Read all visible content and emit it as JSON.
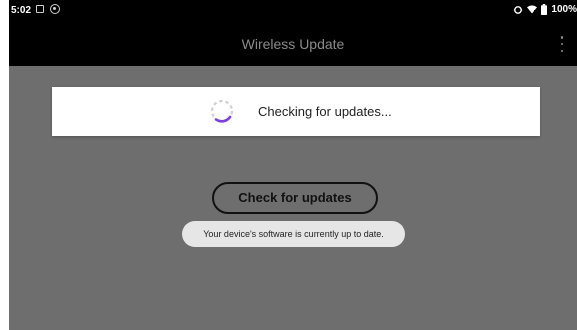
{
  "status_bar": {
    "time": "5:02",
    "battery": "100%"
  },
  "app_bar": {
    "title": "Wireless Update"
  },
  "main": {
    "check_button_label": "Check for updates"
  },
  "progress_dialog": {
    "message": "Checking for updates..."
  },
  "toast": {
    "message": "Your device's software is currently up to date."
  },
  "icons": {
    "status_left": [
      "notification-square-icon",
      "notification-circle-icon"
    ],
    "status_right": [
      "sync-icon",
      "wifi-icon",
      "battery-icon"
    ],
    "app_bar": "more-vert-icon",
    "dialog": "spinner-icon"
  },
  "colors": {
    "status_bar": "#000000",
    "app_bar": "#000000",
    "background": "#6e6e6e",
    "dialog": "#ffffff",
    "spinner_accent": "#7b3fe4",
    "toast": "#e6e6e6"
  }
}
